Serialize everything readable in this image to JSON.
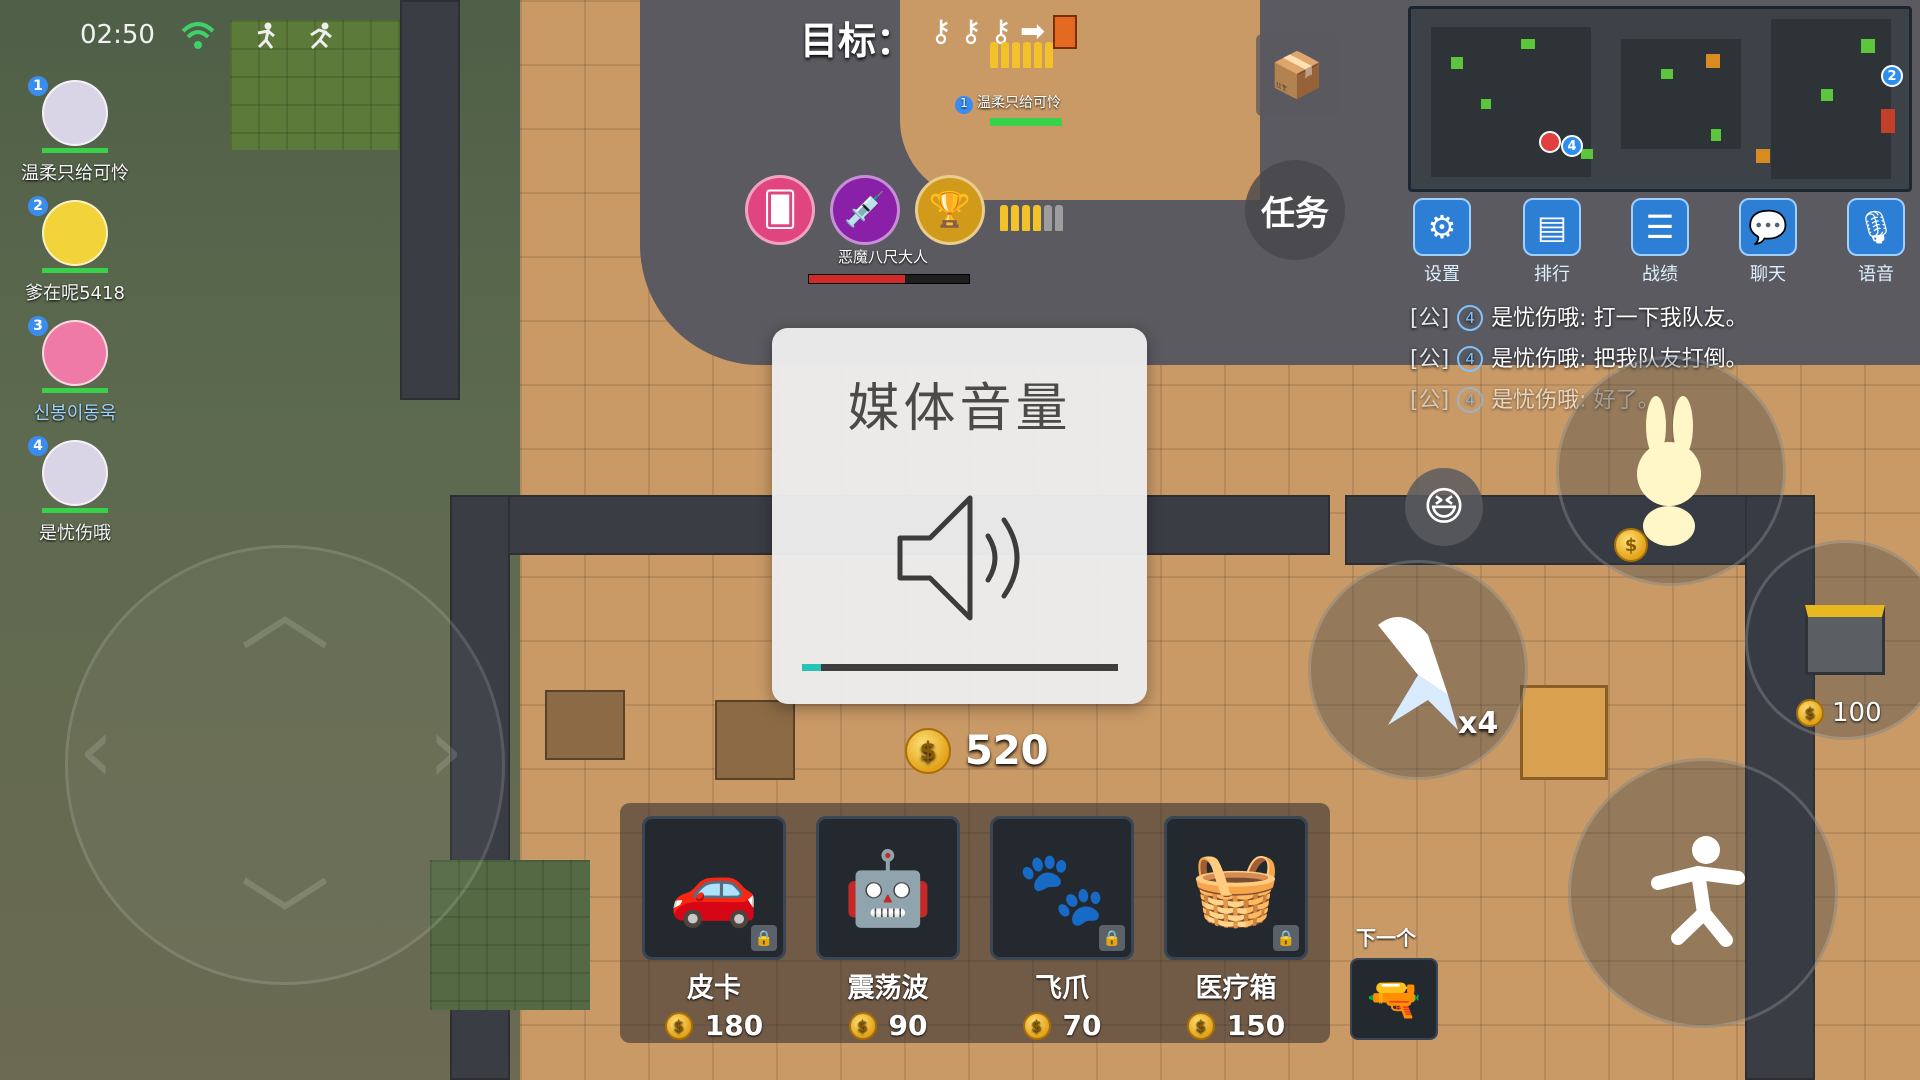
{
  "status": {
    "time": "02:50",
    "wifi_icon": "wifi-icon",
    "icons": [
      "running-figure-icon",
      "sprint-figure-icon"
    ]
  },
  "players": [
    {
      "num": "1",
      "name": "温柔只给可怜",
      "avatar_color": "#d9d4e6"
    },
    {
      "num": "2",
      "name": "爹在呢5418",
      "avatar_color": "#f2d33a"
    },
    {
      "num": "3",
      "name": "신봉이동욱",
      "avatar_color": "#f07aa6"
    },
    {
      "num": "4",
      "name": "是忧伤哦",
      "avatar_color": "#d9d4e6"
    }
  ],
  "goal": {
    "label": "目标：",
    "icons": [
      "key-icon",
      "key-icon",
      "key-icon",
      "arrow-right-icon",
      "door-icon"
    ]
  },
  "teammate_tag": {
    "num": "1",
    "name": "温柔只给可怜"
  },
  "enemy": {
    "name": "恶魔八尺大人",
    "hp_fraction": 0.6
  },
  "task_button": {
    "label": "任务"
  },
  "menu": [
    {
      "label": "设置",
      "icon": "gear-icon"
    },
    {
      "label": "排行",
      "icon": "ranking-icon"
    },
    {
      "label": "战绩",
      "icon": "list-icon"
    },
    {
      "label": "聊天",
      "icon": "chat-bubble-icon"
    },
    {
      "label": "语音",
      "icon": "microphone-icon"
    }
  ],
  "chat": [
    {
      "channel": "[公]",
      "num": "4",
      "text": "是忧伤哦: 打一下我队友。"
    },
    {
      "channel": "[公]",
      "num": "4",
      "text": "是忧伤哦: 把我队友打倒。"
    },
    {
      "channel": "[公]",
      "num": "4",
      "text": "是忧伤哦: 好了。"
    }
  ],
  "minimap": {
    "markers": [
      "2",
      "4"
    ]
  },
  "volume": {
    "title": "媒体音量",
    "level_fraction": 0.06,
    "accent": "#26c4b7"
  },
  "money": {
    "amount": "520"
  },
  "shop": [
    {
      "name": "皮卡",
      "price": "180",
      "icon": "pickup-truck-icon",
      "locked": true
    },
    {
      "name": "震荡波",
      "price": "90",
      "icon": "shockwave-robot-icon",
      "locked": false
    },
    {
      "name": "飞爪",
      "price": "70",
      "icon": "paw-claw-icon",
      "locked": true
    },
    {
      "name": "医疗箱",
      "price": "150",
      "icon": "medical-basket-icon",
      "locked": true
    }
  ],
  "next": {
    "label": "下一个",
    "icon": "toy-gun-icon"
  },
  "skill": {
    "count": "x4",
    "icon": "rocket-icon"
  },
  "side_item": {
    "price": "100",
    "icon": "supply-crate-icon"
  },
  "coin_symbol": "$"
}
